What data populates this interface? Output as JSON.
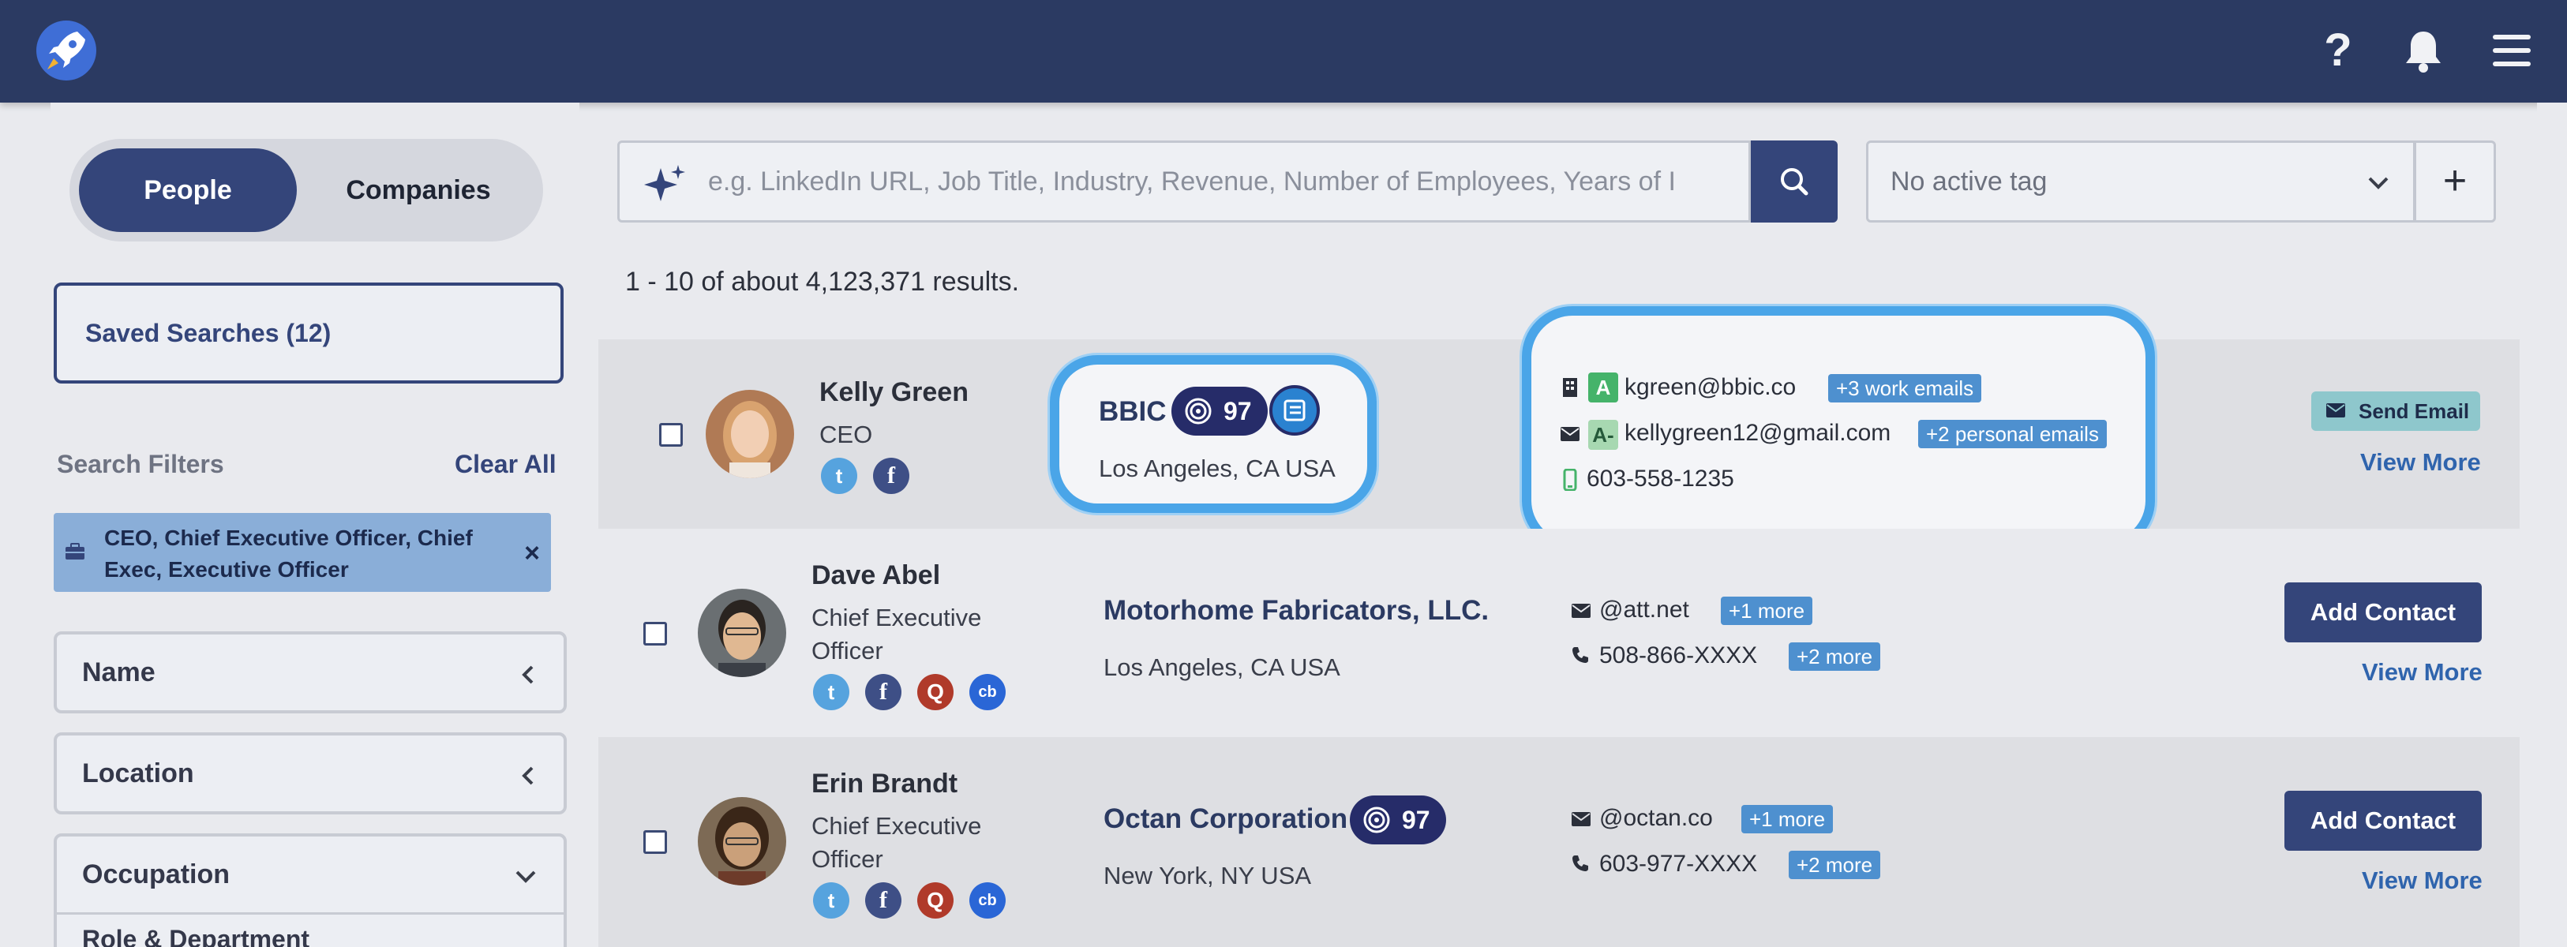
{
  "nav": {
    "logo_icon": "rocket-logo-icon",
    "help_label": "?",
    "icons": [
      "help-icon",
      "bell-icon",
      "hamburger-menu-icon"
    ]
  },
  "sidebar": {
    "toggle": {
      "people": "People",
      "companies": "Companies",
      "selected": "People"
    },
    "saved_searches": "Saved Searches (12)",
    "filters_title": "Search Filters",
    "clear_all": "Clear All",
    "active_filter": "CEO, Chief Executive Officer, Chief Exec, Executive Officer",
    "active_filter_close": "×",
    "accordions": [
      {
        "label": "Name",
        "state": "collapsed"
      },
      {
        "label": "Location",
        "state": "collapsed"
      },
      {
        "label": "Occupation",
        "state": "expanded"
      },
      {
        "label": "Role & Department",
        "state": "collapsed"
      }
    ]
  },
  "search": {
    "placeholder": "e.g. LinkedIn URL, Job Title, Industry, Revenue, Number of Employees, Years of I",
    "tag_select": "No active tag",
    "add_tag": "+"
  },
  "results": {
    "count_text": "1 - 10 of about 4,123,371 results.",
    "rows": [
      {
        "name": "Kelly Green",
        "title": "CEO",
        "company": "BBIC",
        "score": "97",
        "location": "Los Angeles, CA USA",
        "work_grade": "A",
        "work_email": "kgreen@bbic.co",
        "work_more": "+3 work emails",
        "personal_grade": "A-",
        "personal_email": "kellygreen12@gmail.com",
        "personal_more": "+2 personal emails",
        "phone": "603-558-1235",
        "action": "Send Email",
        "view_more": "View More"
      },
      {
        "name": "Dave Abel",
        "title_line1": "Chief Executive",
        "title_line2": "Officer",
        "company": "Motorhome Fabricators, LLC.",
        "location": "Los Angeles, CA USA",
        "email": "@att.net",
        "email_more": "+1 more",
        "phone": "508-866-XXXX",
        "phone_more": "+2 more",
        "action": "Add Contact",
        "view_more": "View More"
      },
      {
        "name": "Erin Brandt",
        "title_line1": "Chief Executive",
        "title_line2": "Officer",
        "company": "Octan Corporation",
        "score": "97",
        "location": "New York, NY USA",
        "email": "@octan.co",
        "email_more": "+1 more",
        "phone": "603-977-XXXX",
        "phone_more": "+2 more",
        "action": "Add Contact",
        "view_more": "View More"
      }
    ]
  },
  "colors": {
    "navbar": "#2b3a62",
    "primary": "#34457a",
    "highlight": "#4aa5e8",
    "score_badge": "#262c69",
    "link": "#2f64ad"
  }
}
